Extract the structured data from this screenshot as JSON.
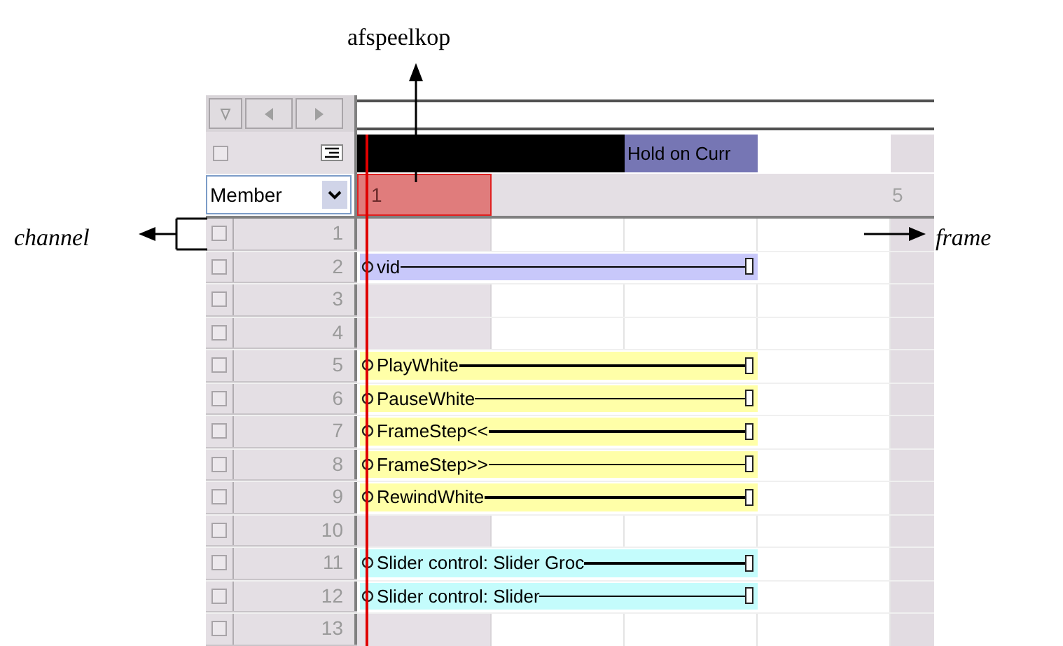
{
  "annotations": {
    "playhead": "afspeelkop",
    "channel": "channel",
    "frame": "frame"
  },
  "score": {
    "marker_label": "Hold on Curr",
    "channel_menu": "Member",
    "frame_numbers": [
      "1",
      "5"
    ],
    "channels": [
      {
        "number": "1"
      },
      {
        "number": "2",
        "sprite": {
          "label": "vid",
          "color": "#c8c8fa"
        }
      },
      {
        "number": "3"
      },
      {
        "number": "4"
      },
      {
        "number": "5",
        "sprite": {
          "label": "PlayWhite",
          "color": "#ffffa8"
        }
      },
      {
        "number": "6",
        "sprite": {
          "label": "PauseWhite",
          "color": "#ffffa8"
        }
      },
      {
        "number": "7",
        "sprite": {
          "label": "FrameStep<<",
          "color": "#ffffa8"
        }
      },
      {
        "number": "8",
        "sprite": {
          "label": "FrameStep>>",
          "color": "#ffffa8"
        }
      },
      {
        "number": "9",
        "sprite": {
          "label": "RewindWhite",
          "color": "#ffffa8"
        }
      },
      {
        "number": "10"
      },
      {
        "number": "11",
        "sprite": {
          "label": "Slider control: Slider Groc",
          "color": "#c4fcfc"
        }
      },
      {
        "number": "12",
        "sprite": {
          "label": "Slider control: Slider",
          "color": "#c4fcfc"
        }
      },
      {
        "number": "13"
      }
    ]
  }
}
